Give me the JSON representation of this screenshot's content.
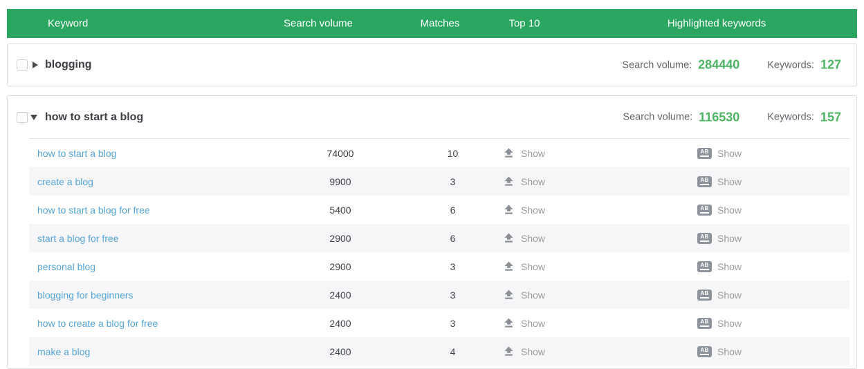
{
  "table_header": {
    "columns": [
      "Keyword",
      "Search volume",
      "Matches",
      "Top 10",
      "Highlighted keywords"
    ]
  },
  "labels": {
    "search_volume_label": "Search volume:",
    "keywords_label": "Keywords:",
    "show": "Show",
    "ab_badge": "AB"
  },
  "colors": {
    "header_bg": "#2aa661",
    "header_text": "#ffffff",
    "value_green": "#4db563",
    "link_blue": "#55a5d9",
    "show_gray": "#9b9b9b",
    "icon_gray": "#8a9096",
    "stripe": "#f6f6f8",
    "card_border": "#dcdcdc"
  },
  "groups": [
    {
      "name": "blogging",
      "state": "collapsed",
      "search_volume": "284440",
      "keyword_count": "127",
      "rows": []
    },
    {
      "name": "how to start a blog",
      "state": "expanded",
      "search_volume": "116530",
      "keyword_count": "157",
      "rows": [
        {
          "keyword": "how to start a blog",
          "search_volume": "74000",
          "matches": "10"
        },
        {
          "keyword": "create a blog",
          "search_volume": "9900",
          "matches": "3"
        },
        {
          "keyword": "how to start a blog for free",
          "search_volume": "5400",
          "matches": "6"
        },
        {
          "keyword": "start a blog for free",
          "search_volume": "2900",
          "matches": "6"
        },
        {
          "keyword": "personal blog",
          "search_volume": "2900",
          "matches": "3"
        },
        {
          "keyword": "blogging for beginners",
          "search_volume": "2400",
          "matches": "3"
        },
        {
          "keyword": "how to create a blog for free",
          "search_volume": "2400",
          "matches": "3"
        },
        {
          "keyword": "make a blog",
          "search_volume": "2400",
          "matches": "4"
        }
      ]
    }
  ]
}
